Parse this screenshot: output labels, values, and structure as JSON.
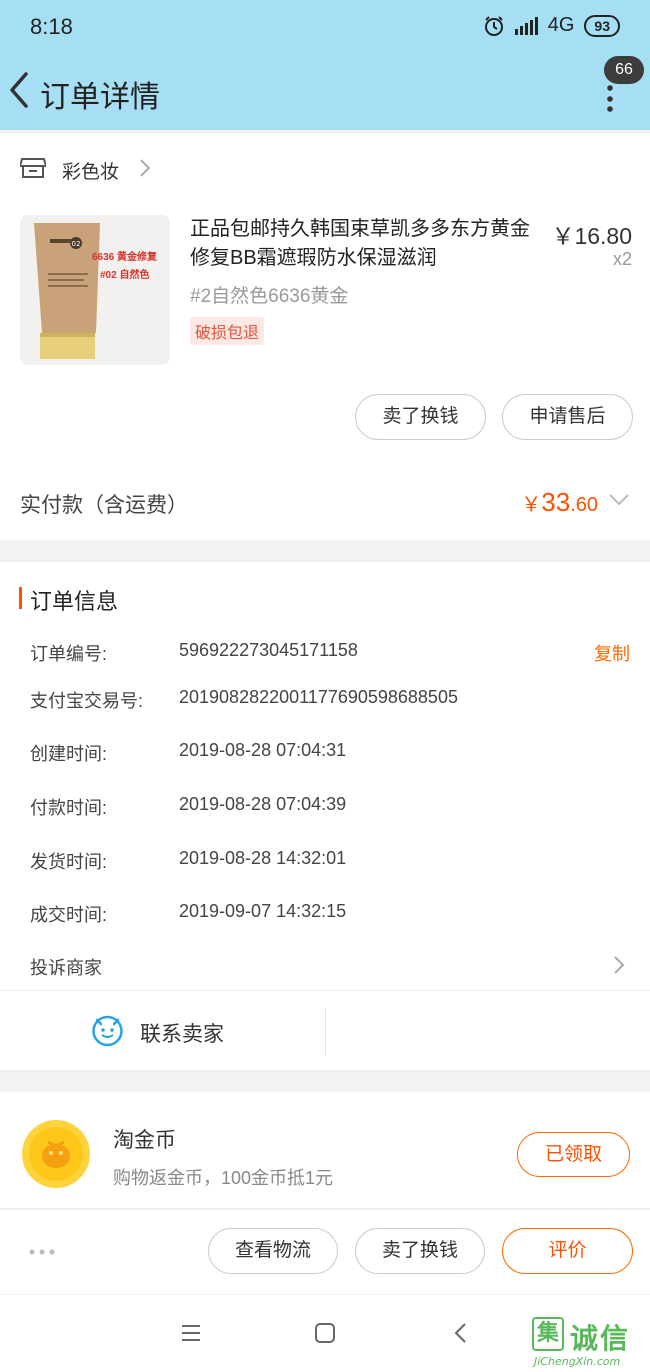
{
  "status_bar": {
    "time": "8:18",
    "network": "4G",
    "battery": "93"
  },
  "header": {
    "title": "订单详情",
    "badge": "66"
  },
  "shop": {
    "name": "彩色妆"
  },
  "product": {
    "title": "正品包邮持久韩国束草凯多多东方黄金修复BB霜遮瑕防水保湿滋润",
    "price": "￥16.80",
    "quantity": "x2",
    "sku": "#2自然色6636黄金",
    "tag": "破损包退",
    "image_text": {
      "line1": "6636 黄金修复",
      "line2": "#02 自然色",
      "number": "02"
    }
  },
  "actions_top": {
    "sell": "卖了换钱",
    "after_sale": "申请售后"
  },
  "payment": {
    "label": "实付款（含运费）",
    "currency": "￥",
    "integer": "33",
    "decimal": ".60"
  },
  "order_info": {
    "title": "订单信息",
    "copy": "复制",
    "rows": [
      {
        "label": "订单编号:",
        "value": "596922273045171158"
      },
      {
        "label": "支付宝交易号:",
        "value": "2019082822001177690598688505"
      },
      {
        "label": "创建时间:",
        "value": "2019-08-28 07:04:31"
      },
      {
        "label": "付款时间:",
        "value": "2019-08-28 07:04:39"
      },
      {
        "label": "发货时间:",
        "value": "2019-08-28 14:32:01"
      },
      {
        "label": "成交时间:",
        "value": "2019-09-07 14:32:15"
      }
    ],
    "complain": "投诉商家",
    "contact": "联系卖家"
  },
  "coins": {
    "title": "淘金币",
    "desc": "购物返金币，100金币抵1元",
    "button": "已领取"
  },
  "bottom_actions": {
    "logistics": "查看物流",
    "sell": "卖了换钱",
    "review": "评价"
  },
  "watermark": {
    "cn": "诚信",
    "box": "集",
    "url": "JiChengXin.com"
  },
  "colors": {
    "header_bg": "#a6dff3",
    "accent": "#ff5000",
    "tag_bg": "#fde8e4",
    "watermark": "#58b85a"
  }
}
